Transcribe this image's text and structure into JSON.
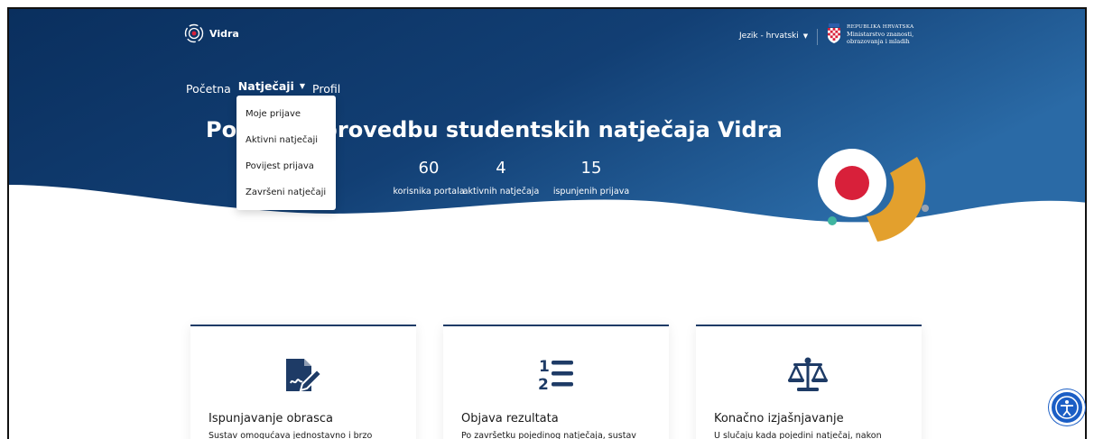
{
  "brand": {
    "name": "Vidra"
  },
  "header": {
    "language_label": "Jezik - hrvatski",
    "ministry": {
      "line1": "REPUBLIKA HRVATSKA",
      "line2": "Ministarstvo znanosti,",
      "line3": "obrazovanja i mladih"
    }
  },
  "nav": {
    "items": [
      {
        "label": "Početna"
      },
      {
        "label": "Natječaji"
      },
      {
        "label": "Profil"
      }
    ]
  },
  "dropdown": {
    "items": [
      {
        "label": "Moje prijave"
      },
      {
        "label": "Aktivni natječaji"
      },
      {
        "label": "Povijest prijava"
      },
      {
        "label": "Završeni natječaji"
      }
    ]
  },
  "hero": {
    "title": "Portal za provedbu studentskih natječaja Vidra",
    "stats": [
      {
        "value": "60",
        "label": "korisnika portala"
      },
      {
        "value": "4",
        "label": "aktivnih natječaja"
      },
      {
        "value": "15",
        "label": "ispunjenih prijava"
      }
    ]
  },
  "cards": [
    {
      "icon": "form-sign-icon",
      "title": "Ispunjavanje obrasca",
      "text": "Sustav omogućava jednostavno i brzo"
    },
    {
      "icon": "ordered-list-icon",
      "title": "Objava rezultata",
      "text": "Po završetku pojedinog natječaja, sustav"
    },
    {
      "icon": "scales-icon",
      "title": "Konačno izjašnjavanje",
      "text": "U slučaju kada pojedini natječaj, nakon"
    }
  ],
  "colors": {
    "hero_dark": "#0b3161",
    "hero_mid": "#1f5a94",
    "accent_red": "#d8203a",
    "accent_orange": "#e3a02d",
    "accent_teal": "#3fb5a0",
    "card_border": "#1e3b66"
  }
}
